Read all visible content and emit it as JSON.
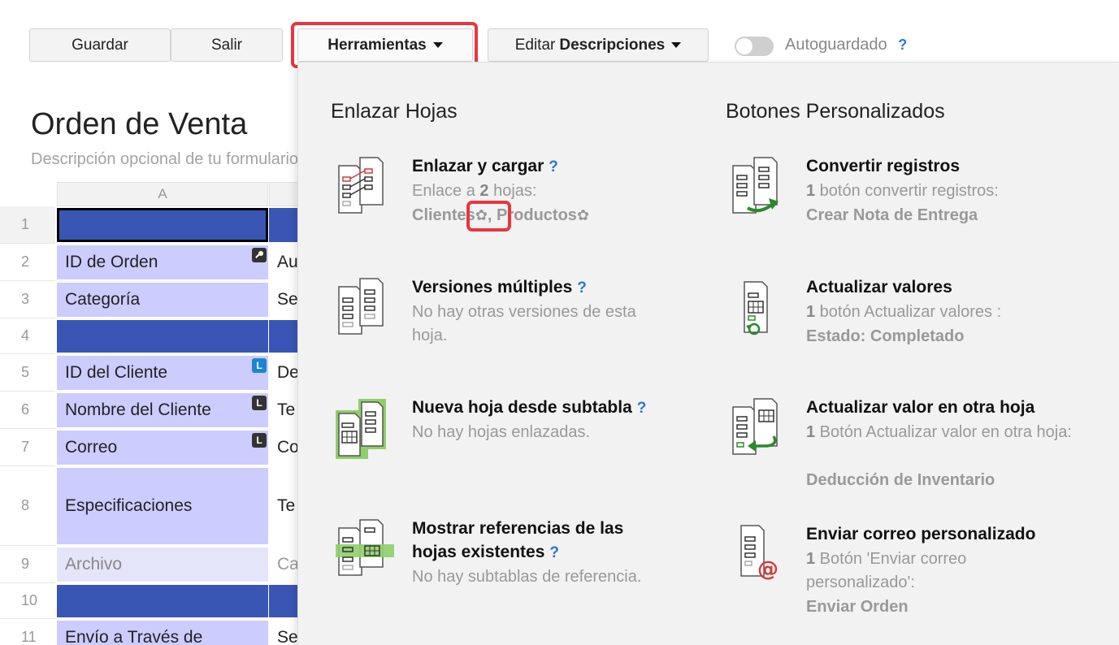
{
  "toolbar": {
    "save_label": "Guardar",
    "exit_label": "Salir",
    "tools_label": "Herramientas",
    "edit_prefix": "Editar",
    "edit_bold": "Descripciones",
    "autosave_label": "Autoguardado",
    "help_mark": "?"
  },
  "form": {
    "title": "Orden de Venta",
    "description": "Descripción opcional de tu formulario",
    "column_a": "A",
    "rows": [
      {
        "num": "1",
        "label": "",
        "value": "",
        "section": true,
        "selected": true
      },
      {
        "num": "2",
        "label": "ID de Orden",
        "value": "Au",
        "badge": "key"
      },
      {
        "num": "3",
        "label": "Categoría",
        "value": "Se"
      },
      {
        "num": "4",
        "label": "",
        "value": "",
        "section": true
      },
      {
        "num": "5",
        "label": "ID del Cliente",
        "value": "De",
        "badge": "L"
      },
      {
        "num": "6",
        "label": "Nombre del Cliente",
        "value": "Te",
        "badge": "L"
      },
      {
        "num": "7",
        "label": "Correo",
        "value": "Co",
        "badge": "L"
      },
      {
        "num": "8",
        "label": "Especificaciones",
        "value": "Te"
      },
      {
        "num": "9",
        "label": "Archivo",
        "value": "Ca"
      },
      {
        "num": "10",
        "label": "",
        "value": "",
        "section": true
      },
      {
        "num": "11",
        "label": "Envío a Través de",
        "value": "Se"
      }
    ]
  },
  "panel": {
    "left_title": "Enlazar Hojas",
    "right_title": "Botones Personalizados",
    "link_load": {
      "title": "Enlazar y cargar",
      "desc_prefix": "Enlace a ",
      "desc_count": "2",
      "desc_suffix": " hojas:",
      "sheet1": "Clientes",
      "separator": ",",
      "sheet2": "Productos"
    },
    "multi_versions": {
      "title": "Versiones múltiples",
      "desc": "No hay otras versiones de esta hoja."
    },
    "new_sheet": {
      "title": "Nueva hoja desde subtabla",
      "desc": "No hay hojas enlazadas."
    },
    "show_refs": {
      "title_line1": "Mostrar referencias de las",
      "title_line2": "hojas existentes",
      "desc": "No hay subtablas de referencia."
    },
    "convert": {
      "title": "Convertir registros",
      "count": "1",
      "desc": " botón convertir registros:",
      "target": "Crear Nota de Entrega"
    },
    "update_values": {
      "title": "Actualizar valores",
      "count": "1",
      "desc": " botón Actualizar valores :",
      "target": "Estado: Completado"
    },
    "update_other": {
      "title": "Actualizar valor en otra hoja",
      "count": "1",
      "desc": " Botón Actualizar valor en otra hoja:",
      "target": "Deducción de Inventario"
    },
    "send_mail": {
      "title": "Enviar correo personalizado",
      "count": "1",
      "desc": " Botón 'Enviar correo personalizado':",
      "target": "Enviar Orden"
    }
  },
  "colors": {
    "highlight": "#e8363f",
    "section_blue": "#3a56b5",
    "field_lavender": "#ccccff",
    "help_blue": "#2a78d1",
    "icon_green": "#2a8a2a",
    "icon_red": "#d23a3a"
  }
}
